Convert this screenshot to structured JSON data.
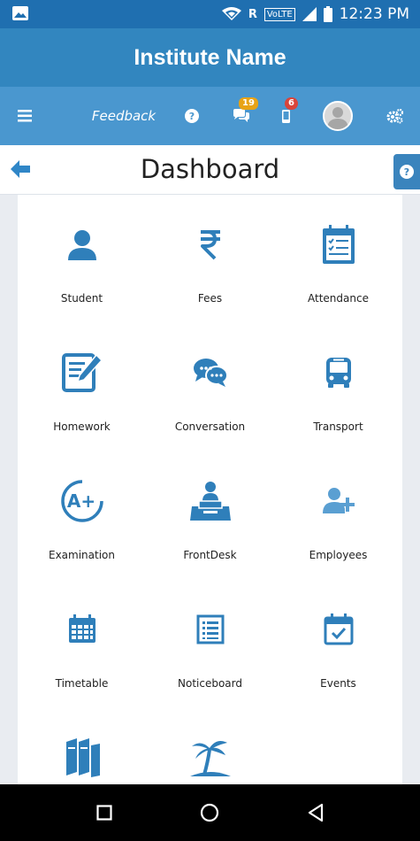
{
  "status_bar": {
    "time": "12:23 PM",
    "network_label": "VoLTE",
    "roaming": "R"
  },
  "app": {
    "title": "Institute Name"
  },
  "toolbar": {
    "feedback_label": "Feedback",
    "messages_badge": "19",
    "notifications_badge": "6"
  },
  "page": {
    "title": "Dashboard"
  },
  "tiles": [
    {
      "label": "Student",
      "icon": "student-icon"
    },
    {
      "label": "Fees",
      "icon": "rupee-icon"
    },
    {
      "label": "Attendance",
      "icon": "attendance-icon"
    },
    {
      "label": "Homework",
      "icon": "homework-icon"
    },
    {
      "label": "Conversation",
      "icon": "conversation-icon"
    },
    {
      "label": "Transport",
      "icon": "bus-icon"
    },
    {
      "label": "Examination",
      "icon": "grade-icon"
    },
    {
      "label": "FrontDesk",
      "icon": "frontdesk-icon"
    },
    {
      "label": "Employees",
      "icon": "add-user-icon"
    },
    {
      "label": "Timetable",
      "icon": "calendar-grid-icon"
    },
    {
      "label": "Noticeboard",
      "icon": "noticeboard-icon"
    },
    {
      "label": "Events",
      "icon": "calendar-check-icon"
    },
    {
      "label": "",
      "icon": "books-icon"
    },
    {
      "label": "",
      "icon": "palm-tree-icon"
    }
  ],
  "colors": {
    "primary": "#3286bf",
    "toolbar": "#4a97cf",
    "status": "#1f6fb0",
    "icon": "#2f7fba"
  }
}
